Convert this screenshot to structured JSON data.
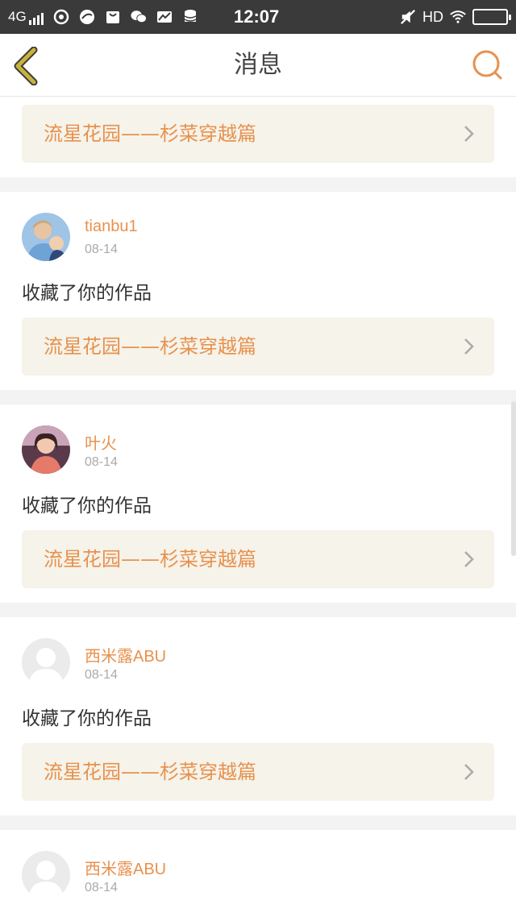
{
  "status_bar": {
    "network": "4G",
    "time": "12:07",
    "hd": "HD",
    "icons": [
      "signal-icon",
      "app-icon",
      "app-icon",
      "bag-icon",
      "wechat-icon",
      "mail-icon",
      "database-icon",
      "mute-icon",
      "wifi-icon",
      "battery-icon"
    ]
  },
  "header": {
    "title": "消息",
    "back_icon": "chevron-left-icon",
    "search_icon": "search-icon"
  },
  "colors": {
    "accent": "#e8914d",
    "back_icon": "#c9b23a",
    "link_bg": "#f5f3ea"
  },
  "messages": [
    {
      "username": "",
      "date": "",
      "action": "",
      "work_title": "流星花园——杉菜穿越篇",
      "partial": true
    },
    {
      "username": "tianbu1",
      "date": "08-14",
      "action": "收藏了你的作品",
      "work_title": "流星花园——杉菜穿越篇",
      "avatar": "photo-avatar"
    },
    {
      "username": "叶火",
      "date": "08-14",
      "action": "收藏了你的作品",
      "work_title": "流星花园——杉菜穿越篇",
      "avatar": "photo-avatar"
    },
    {
      "username": "西米露ABU",
      "date": "08-14",
      "action": "收藏了你的作品",
      "work_title": "流星花园——杉菜穿越篇",
      "avatar": "default-avatar"
    },
    {
      "username": "西米露ABU",
      "date": "08-14",
      "action": "",
      "work_title": "",
      "avatar": "default-avatar"
    }
  ]
}
